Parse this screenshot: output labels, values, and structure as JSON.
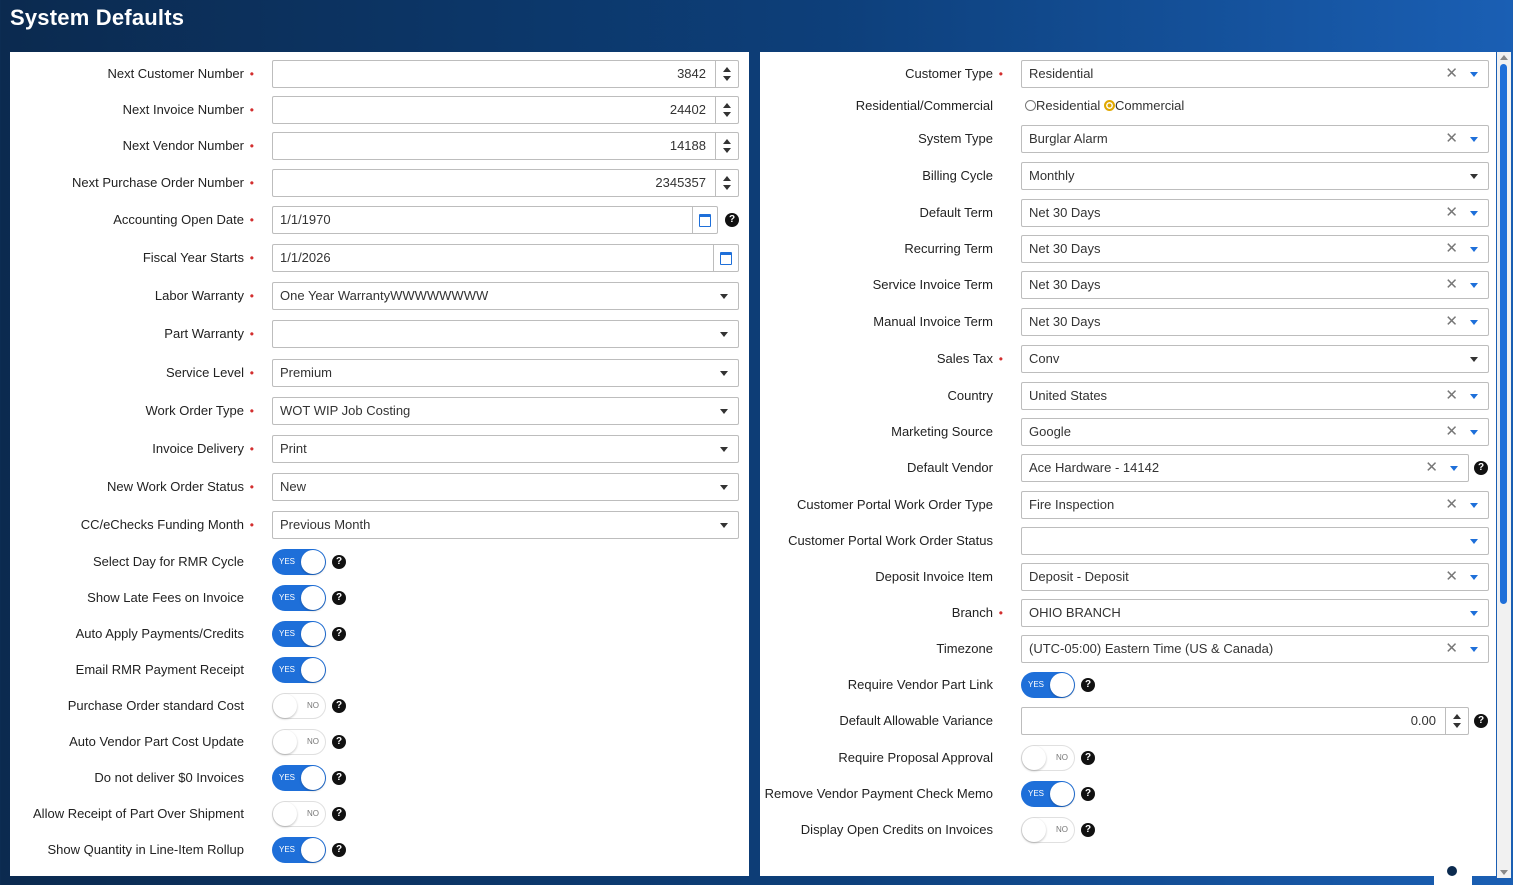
{
  "title": "System Defaults",
  "left": {
    "next_customer_number": {
      "label": "Next Customer Number",
      "value": "3842"
    },
    "next_invoice_number": {
      "label": "Next Invoice Number",
      "value": "24402"
    },
    "next_vendor_number": {
      "label": "Next Vendor Number",
      "value": "14188"
    },
    "next_po_number": {
      "label": "Next Purchase Order Number",
      "value": "2345357"
    },
    "accounting_open_date": {
      "label": "Accounting Open Date",
      "value": "1/1/1970"
    },
    "fiscal_year_starts": {
      "label": "Fiscal Year Starts",
      "value": "1/1/2026"
    },
    "labor_warranty": {
      "label": "Labor Warranty",
      "value": "One Year WarrantyWWWWWWWW"
    },
    "part_warranty": {
      "label": "Part Warranty",
      "value": ""
    },
    "service_level": {
      "label": "Service Level",
      "value": "Premium"
    },
    "work_order_type": {
      "label": "Work Order Type",
      "value": "WOT WIP Job Costing"
    },
    "invoice_delivery": {
      "label": "Invoice Delivery",
      "value": "Print"
    },
    "new_work_order_status": {
      "label": "New Work Order Status",
      "value": "New"
    },
    "funding_month": {
      "label": "CC/eChecks Funding Month",
      "value": "Previous Month"
    },
    "toggles": [
      {
        "label": "Select Day for RMR Cycle",
        "state": "YES"
      },
      {
        "label": "Show Late Fees on Invoice",
        "state": "YES"
      },
      {
        "label": "Auto Apply Payments/Credits",
        "state": "YES"
      },
      {
        "label": "Email RMR Payment Receipt",
        "state": "YES"
      },
      {
        "label": "Purchase Order standard Cost",
        "state": "NO"
      },
      {
        "label": "Auto Vendor Part Cost Update",
        "state": "NO"
      },
      {
        "label": "Do not deliver $0 Invoices",
        "state": "YES"
      },
      {
        "label": "Allow Receipt of Part Over Shipment",
        "state": "NO"
      },
      {
        "label": "Show Quantity in Line-Item Rollup",
        "state": "YES"
      }
    ]
  },
  "right": {
    "customer_type": {
      "label": "Customer Type",
      "value": "Residential"
    },
    "res_com": {
      "label": "Residential/Commercial",
      "opt1": "Residential",
      "opt2": "Commercial",
      "selected": "Commercial"
    },
    "system_type": {
      "label": "System Type",
      "value": "Burglar Alarm"
    },
    "billing_cycle": {
      "label": "Billing Cycle",
      "value": "Monthly"
    },
    "default_term": {
      "label": "Default Term",
      "value": "Net 30 Days"
    },
    "recurring_term": {
      "label": "Recurring Term",
      "value": "Net 30 Days"
    },
    "service_invoice_term": {
      "label": "Service Invoice Term",
      "value": "Net 30 Days"
    },
    "manual_invoice_term": {
      "label": "Manual Invoice Term",
      "value": "Net 30 Days"
    },
    "sales_tax": {
      "label": "Sales Tax",
      "value": "Conv"
    },
    "country": {
      "label": "Country",
      "value": "United States"
    },
    "marketing_source": {
      "label": "Marketing Source",
      "value": "Google"
    },
    "default_vendor": {
      "label": "Default Vendor",
      "value": "Ace Hardware - 14142"
    },
    "portal_wo_type": {
      "label": "Customer Portal Work Order Type",
      "value": "Fire Inspection"
    },
    "portal_wo_status": {
      "label": "Customer Portal Work Order Status",
      "value": ""
    },
    "deposit_item": {
      "label": "Deposit Invoice Item",
      "value": "Deposit - Deposit"
    },
    "branch": {
      "label": "Branch",
      "value": "OHIO BRANCH"
    },
    "timezone": {
      "label": "Timezone",
      "value": "(UTC-05:00) Eastern Time (US & Canada)"
    },
    "require_vendor_part_link": {
      "label": "Require Vendor Part Link",
      "state": "YES"
    },
    "allowable_variance": {
      "label": "Default Allowable Variance",
      "value": "0.00"
    },
    "require_proposal_approval": {
      "label": "Require Proposal Approval",
      "state": "NO"
    },
    "remove_check_memo": {
      "label": "Remove Vendor Payment Check Memo",
      "state": "YES"
    },
    "display_open_credits": {
      "label": "Display Open Credits on Invoices",
      "state": "NO"
    }
  },
  "help_glyph": "?",
  "clear_glyph": "✕",
  "colors": {
    "accent": "#1e6fd9",
    "required": "#d32f2f",
    "header_dark": "#0b2a4f"
  }
}
